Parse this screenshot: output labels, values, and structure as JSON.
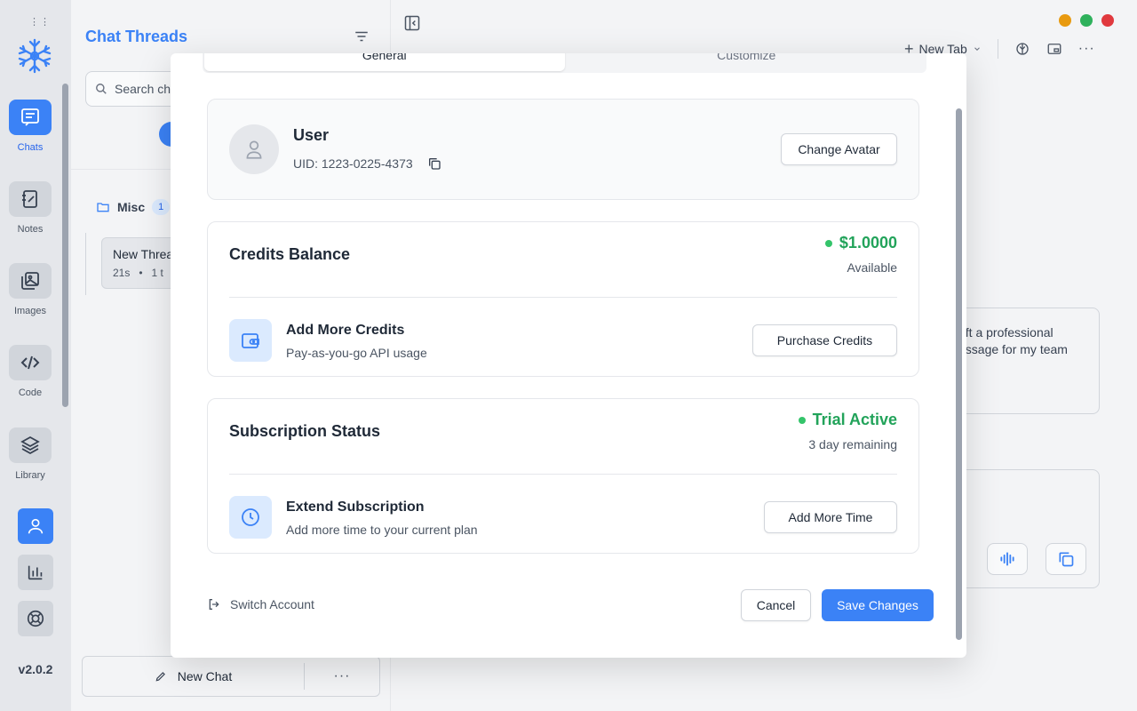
{
  "rail": {
    "grip": "⋮⋮",
    "items": [
      {
        "label": "Chats",
        "icon": "chat-icon"
      },
      {
        "label": "Notes",
        "icon": "notes-icon"
      },
      {
        "label": "Images",
        "icon": "images-icon"
      },
      {
        "label": "Code",
        "icon": "code-icon"
      },
      {
        "label": "Library",
        "icon": "layers-icon"
      }
    ],
    "version": "v2.0.2"
  },
  "threads": {
    "title": "Chat Threads",
    "search_placeholder": "Search ch",
    "folder": {
      "name": "Misc",
      "count": "1"
    },
    "thread": {
      "title": "New Threa",
      "meta": "21s   •   1 t"
    },
    "new_chat_label": "New Chat"
  },
  "main": {
    "new_tab_label": "New Tab",
    "card_text_line1": "aft a professional",
    "card_text_line2": "essage for my team"
  },
  "modal": {
    "tabs": [
      "General",
      "Customize"
    ],
    "user": {
      "name": "User",
      "uid": "UID: 1223-0225-4373",
      "change_avatar": "Change Avatar"
    },
    "credits": {
      "title": "Credits Balance",
      "value": "$1.0000",
      "status": "Available",
      "row_title": "Add More Credits",
      "row_sub": "Pay-as-you-go API usage",
      "button": "Purchase Credits"
    },
    "subscription": {
      "title": "Subscription Status",
      "value": "Trial Active",
      "status": "3 day remaining",
      "row_title": "Extend Subscription",
      "row_sub": "Add more time to your current plan",
      "button": "Add More Time"
    },
    "switch_account": "Switch Account",
    "cancel": "Cancel",
    "save": "Save Changes"
  },
  "colors": {
    "accent": "#3b82f6",
    "success": "#22a35a",
    "traffic_yellow": "#e89a10",
    "traffic_green": "#2fb15c",
    "traffic_red": "#e0393e"
  }
}
